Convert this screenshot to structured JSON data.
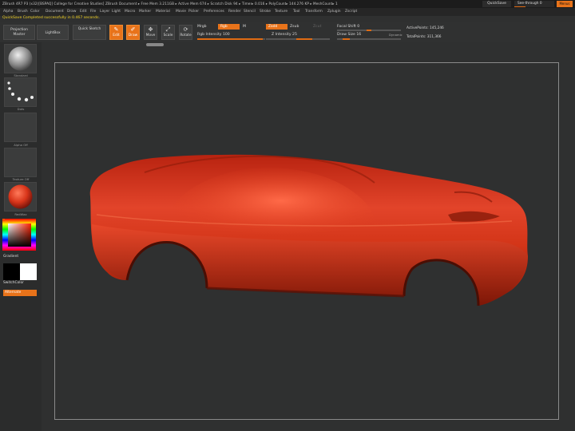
{
  "titlebar": {
    "title": "ZBrush 4R7 P3 (x32)[BSPAQ] College for Creative Studies]   ZBrush Document      ▸ Free Mem 3.211GB ▸ Active Mem 674 ▸ Scratch Disk 94 ▸ Timer▸ 0.016 ▸ PolyCount▸ 144.276 KP ▸ MeshCount▸ 1",
    "quicksave": "QuickSave",
    "see_through": "See-through  0",
    "menus": "Menus"
  },
  "menubar": {
    "items": [
      "Alpha",
      "Brush",
      "Color",
      "Document",
      "Draw",
      "Edit",
      "File",
      "Layer",
      "Light",
      "Macro",
      "Marker",
      "Material",
      "Movie",
      "Picker",
      "Preferences",
      "Render",
      "Stencil",
      "Stroke",
      "Texture",
      "Tool",
      "Transform",
      "Zplugin",
      "Zscript"
    ]
  },
  "notice": "QuickSave Completed successfully in 0.467 seconds.",
  "toolbar": {
    "projection_master": "Projection Master",
    "lightbox": "LightBox",
    "quick_sketch": "Quick Sketch",
    "edit": "Edit",
    "draw": "Draw",
    "move": "Move",
    "scale": "Scale",
    "rotate": "Rotate",
    "mrgb": "Mrgb",
    "rgb": "Rgb",
    "m": "M",
    "rgb_intensity": "Rgb Intensity 100",
    "zadd": "Zadd",
    "zsub": "Zsub",
    "zcut": "Zcut",
    "z_intensity": "Z Intensity 25",
    "focal_shift": "Focal Shift 0",
    "draw_size": "Draw Size 16",
    "dynamic": "Dynamic",
    "active_points": "ActivePoints: 145,246",
    "total_points": "TotalPoints: 311,366"
  },
  "shelf": {
    "brush_caption": "Standard",
    "stroke_caption": "Dots",
    "alpha_caption": "Alpha Off",
    "texture_caption": "Texture Off",
    "material_caption": "RedWax",
    "gradient": "Gradient",
    "switch_color": "SwitchColor",
    "alternate": "Alternate"
  },
  "colors": {
    "accent": "#e8731a",
    "car_body": "#d8351a",
    "canvas_bg": "#2f3030"
  }
}
